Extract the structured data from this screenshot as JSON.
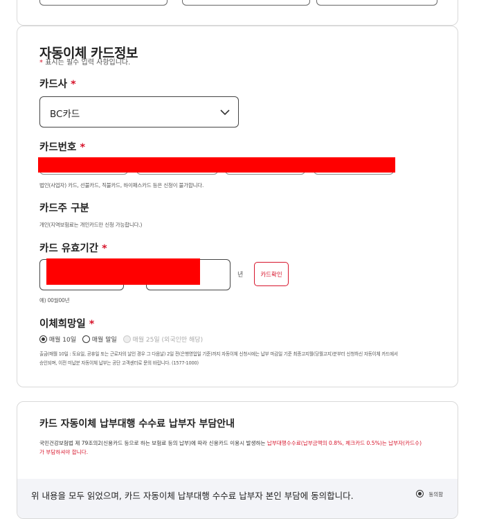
{
  "section": {
    "title": "자동이체 카드정보",
    "required_note": "표시는 필수 입력 사항입니다."
  },
  "card_company": {
    "label": "카드사",
    "selected": "BC카드"
  },
  "card_number": {
    "label": "카드번호",
    "note": "법인(사업자) 카드, 선불카드, 직불카드, 하이패스카드 등은 신청이 불가합니다."
  },
  "card_owner": {
    "label": "카드주 구분",
    "note": "개인(지역보험료는 개인카드만 신청 가능합니다.)"
  },
  "expiry": {
    "label": "카드 유효기간",
    "year_unit": "년",
    "verify_button": "카드확인",
    "example": "예) 00월00년"
  },
  "transfer_day": {
    "label": "이체희망일",
    "options": [
      {
        "label": "매월 10일"
      },
      {
        "label": "매월 말일"
      },
      {
        "label": "매월 25일 (외국인만 해당)"
      }
    ],
    "note_line1": "출금(매월 10일 : 토요일, 공휴일 또는 근로자의 날인 경우 그 다음날) 2일 전(은행영업일 기준)까지 자동이체 신청시에는 납부 마감일 기준 최종고지월(당월고지)분부터 신청하신 자동이체 카드에서",
    "note_line2": "승인되며, 이전 미납분 자동이체 납부는 공단 고객센터로 문의 바랍니다. (1577-1000)"
  },
  "fee_section": {
    "title": "카드 자동이체 납부대행 수수료 납부자 부담안내",
    "text_part1": "국민건강보험법 제 79조의2(신용카드 등으로 하는 보험료 등의 납부)에 따라 신용카드 이용시 발생하는 ",
    "text_highlight": "납부대행수수료(납부금액의 0.8%, 체크카드 0.5%)는 납부자(카드수)",
    "text_part2": "가 부담하셔야 합니다."
  },
  "agreement": {
    "text": "위 내용을 모두 읽었으며, 카드 자동이체 납부대행 수수료 납부자 본인 부담에 동의합니다.",
    "radio_label": "동의함"
  },
  "colors": {
    "required": "#d7142b",
    "redaction": "#ff0000",
    "border": "#d9d9d9",
    "agree_bg": "#f3f4f8"
  }
}
